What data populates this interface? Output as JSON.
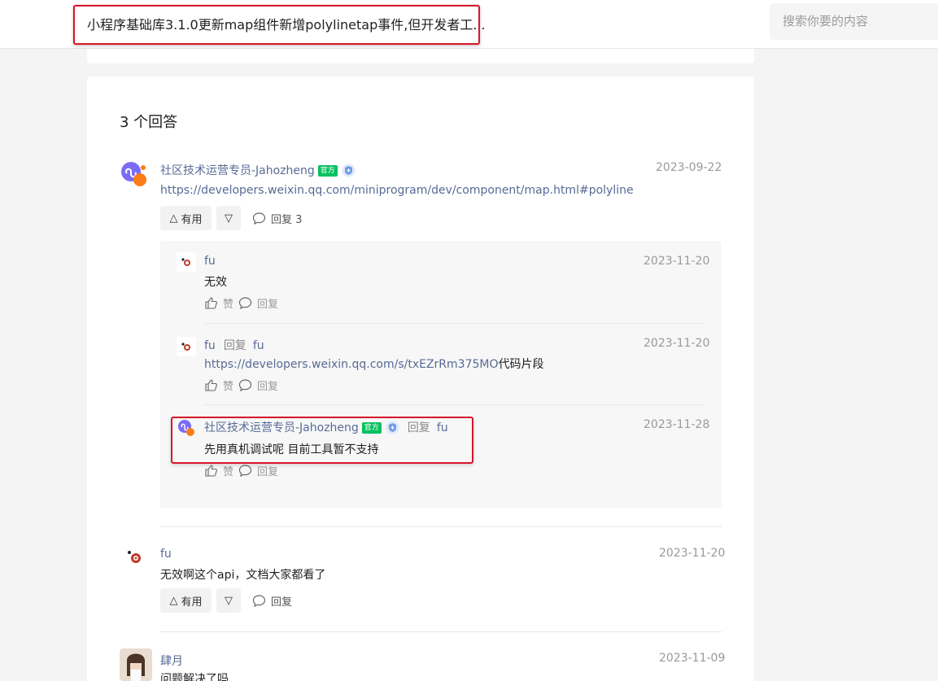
{
  "header": {
    "title": "小程序基础库3.1.0更新map组件新增polylinetap事件,但开发者工...",
    "search_placeholder": "搜索你要的内容"
  },
  "answers": {
    "count_label": "3 个回答",
    "useful_label": "有用",
    "items": [
      {
        "author": "社区技术运营专员-Jahozheng",
        "official_badge": "官方",
        "date": "2023-09-22",
        "content": "https://developers.weixin.qq.com/miniprogram/dev/component/map.html#polyline",
        "reply_label": "回复 3",
        "replies": [
          {
            "author": "fu",
            "date": "2023-11-20",
            "content": "无效",
            "like_label": "赞",
            "reply_label": "回复"
          },
          {
            "author": "fu",
            "reply_word": "回复",
            "reply_to": "fu",
            "date": "2023-11-20",
            "content_link": "https://developers.weixin.qq.com/s/txEZrRm375MO",
            "content_suffix": "代码片段",
            "like_label": "赞",
            "reply_label": "回复"
          },
          {
            "author": "社区技术运营专员-Jahozheng",
            "official_badge": "官方",
            "reply_word": "回复",
            "reply_to": "fu",
            "date": "2023-11-28",
            "content": "先用真机调试呢 目前工具暂不支持",
            "like_label": "赞",
            "reply_label": "回复"
          }
        ]
      },
      {
        "author": "fu",
        "date": "2023-11-20",
        "content": "无效啊这个api，文档大家都看了",
        "reply_label": "回复"
      },
      {
        "author": "肆月",
        "date": "2023-11-09",
        "content": "问题解决了吗"
      }
    ]
  },
  "colors": {
    "link": "#576b95",
    "official": "#07c160",
    "highlight": "#d7172a"
  },
  "icons": [
    "triangle-up-icon",
    "triangle-down-icon",
    "comment-icon",
    "thumbs-up-icon",
    "shield-icon",
    "miniprogram-logo-icon"
  ]
}
